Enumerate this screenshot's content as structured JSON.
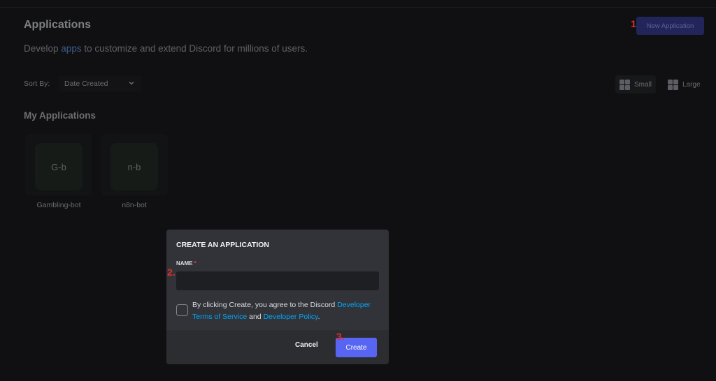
{
  "header": {
    "title": "Applications",
    "subtitle_prefix": "Develop",
    "subtitle_link": "apps",
    "subtitle_suffix": "to customize and extend Discord for millions of users.",
    "new_app_label": "New Application"
  },
  "steps": {
    "one": "1.",
    "two": "2.",
    "three": "3."
  },
  "sort": {
    "label": "Sort By:",
    "value": "Date Created"
  },
  "view": {
    "small": "Small",
    "large": "Large",
    "selected": "Small"
  },
  "section_title": "My Applications",
  "apps": [
    {
      "initials": "G-b",
      "name": "Gambling-bot"
    },
    {
      "initials": "n-b",
      "name": "n8n-bot"
    }
  ],
  "modal": {
    "title": "CREATE AN APPLICATION",
    "name_label": "NAME",
    "required_mark": "*",
    "name_value": "",
    "agree_prefix": "By clicking Create, you agree to the Discord",
    "terms_link": "Developer Terms of Service",
    "and": "and",
    "policy_link": "Developer Policy",
    "period": ".",
    "cancel_label": "Cancel",
    "create_label": "Create"
  },
  "colors": {
    "accent": "#5865f2",
    "link": "#00a8fc",
    "step_marker": "#e0302c",
    "modal_bg": "#313338",
    "page_bg": "#101012"
  }
}
